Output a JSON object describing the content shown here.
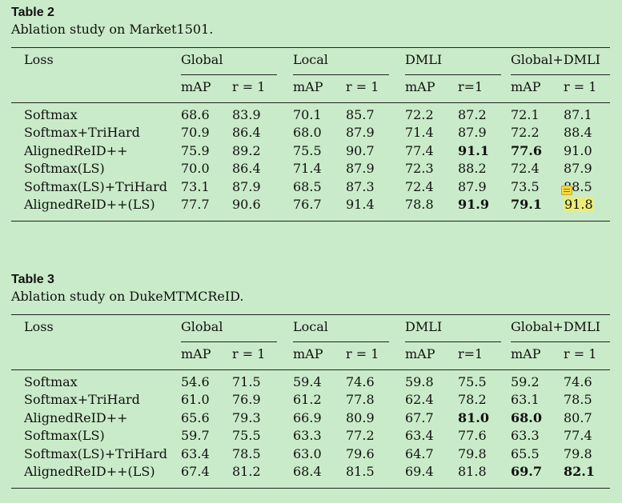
{
  "tables": [
    {
      "label": "Table 2",
      "caption": "Ablation study on Market1501.",
      "loss_header": "Loss",
      "groups": [
        "Global",
        "Local",
        "DMLI",
        "Global+DMLI"
      ],
      "subheaders": [
        "mAP",
        "r = 1",
        "mAP",
        "r = 1",
        "mAP",
        "r=1",
        "mAP",
        "r = 1"
      ],
      "rows": [
        {
          "loss": "Softmax",
          "values": [
            "68.6",
            "83.9",
            "70.1",
            "85.7",
            "72.2",
            "87.2",
            "72.1",
            "87.1"
          ],
          "bold": []
        },
        {
          "loss": "Softmax+TriHard",
          "values": [
            "70.9",
            "86.4",
            "68.0",
            "87.9",
            "71.4",
            "87.9",
            "72.2",
            "88.4"
          ],
          "bold": []
        },
        {
          "loss": "AlignedReID++",
          "values": [
            "75.9",
            "89.2",
            "75.5",
            "90.7",
            "77.4",
            "91.1",
            "77.6",
            "91.0"
          ],
          "bold": [
            5,
            6
          ]
        },
        {
          "loss": "Softmax(LS)",
          "values": [
            "70.0",
            "86.4",
            "71.4",
            "87.9",
            "72.3",
            "88.2",
            "72.4",
            "87.9"
          ],
          "bold": []
        },
        {
          "loss": "Softmax(LS)+TriHard",
          "values": [
            "73.1",
            "87.9",
            "68.5",
            "87.3",
            "72.4",
            "87.9",
            "73.5",
            "88.5"
          ],
          "bold": []
        },
        {
          "loss": "AlignedReID++(LS)",
          "values": [
            "77.7",
            "90.6",
            "76.7",
            "91.4",
            "78.8",
            "91.9",
            "79.1",
            "91.8"
          ],
          "bold": [
            5,
            6
          ],
          "highlight": [
            7
          ]
        }
      ]
    },
    {
      "label": "Table 3",
      "caption": "Ablation study on DukeMTMCReID.",
      "loss_header": "Loss",
      "groups": [
        "Global",
        "Local",
        "DMLI",
        "Global+DMLI"
      ],
      "subheaders": [
        "mAP",
        "r = 1",
        "mAP",
        "r = 1",
        "mAP",
        "r=1",
        "mAP",
        "r = 1"
      ],
      "rows": [
        {
          "loss": "Softmax",
          "values": [
            "54.6",
            "71.5",
            "59.4",
            "74.6",
            "59.8",
            "75.5",
            "59.2",
            "74.6"
          ],
          "bold": []
        },
        {
          "loss": "Softmax+TriHard",
          "values": [
            "61.0",
            "76.9",
            "61.2",
            "77.8",
            "62.4",
            "78.2",
            "63.1",
            "78.5"
          ],
          "bold": []
        },
        {
          "loss": "AlignedReID++",
          "values": [
            "65.6",
            "79.3",
            "66.9",
            "80.9",
            "67.7",
            "81.0",
            "68.0",
            "80.7"
          ],
          "bold": [
            5,
            6
          ]
        },
        {
          "loss": "Softmax(LS)",
          "values": [
            "59.7",
            "75.5",
            "63.3",
            "77.2",
            "63.4",
            "77.6",
            "63.3",
            "77.4"
          ],
          "bold": []
        },
        {
          "loss": "Softmax(LS)+TriHard",
          "values": [
            "63.4",
            "78.5",
            "63.0",
            "79.6",
            "64.7",
            "79.8",
            "65.5",
            "79.8"
          ],
          "bold": []
        },
        {
          "loss": "AlignedReID++(LS)",
          "values": [
            "67.4",
            "81.2",
            "68.4",
            "81.5",
            "69.4",
            "81.8",
            "69.7",
            "82.1"
          ],
          "bold": [
            6,
            7
          ]
        }
      ]
    }
  ],
  "annotation": {
    "icon": "sticky-note-icon"
  }
}
